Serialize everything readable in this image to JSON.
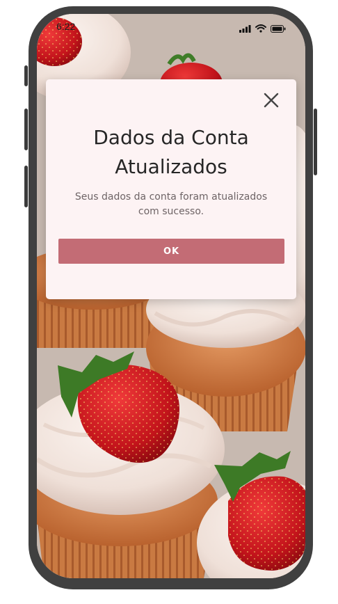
{
  "status_bar": {
    "time": "6:22",
    "icons": [
      "cellular-signal-icon",
      "wifi-icon",
      "battery-icon"
    ]
  },
  "background": {
    "description_icon": "cupcakes-photo"
  },
  "dialog": {
    "title": "Dados da Conta Atualizados",
    "message": "Seus dados da conta foram atualizados com sucesso.",
    "ok_label": "OK",
    "close_icon": "close-icon"
  },
  "colors": {
    "dialog_bg": "#fdf3f4",
    "ok_button": "#c36c75",
    "phone_frame": "#404040"
  }
}
